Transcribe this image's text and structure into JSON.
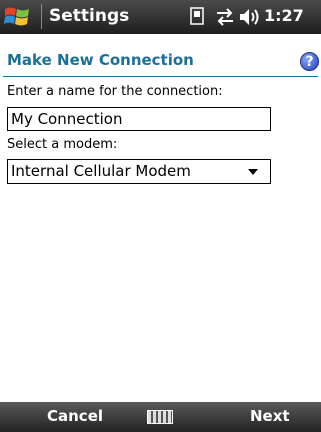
{
  "titlebar": {
    "title": "Settings",
    "time": "1:27",
    "icons": [
      "windows-flag-icon",
      "sim-icon",
      "connectivity-arrows-icon",
      "speaker-icon"
    ]
  },
  "header": {
    "title": "Make New Connection",
    "help_label": "?"
  },
  "form": {
    "name_label": "Enter a name for the connection:",
    "name_value": "My Connection",
    "modem_label": "Select a modem:",
    "modem_value": "Internal Cellular Modem"
  },
  "softkeys": {
    "left": "Cancel",
    "right": "Next"
  }
}
